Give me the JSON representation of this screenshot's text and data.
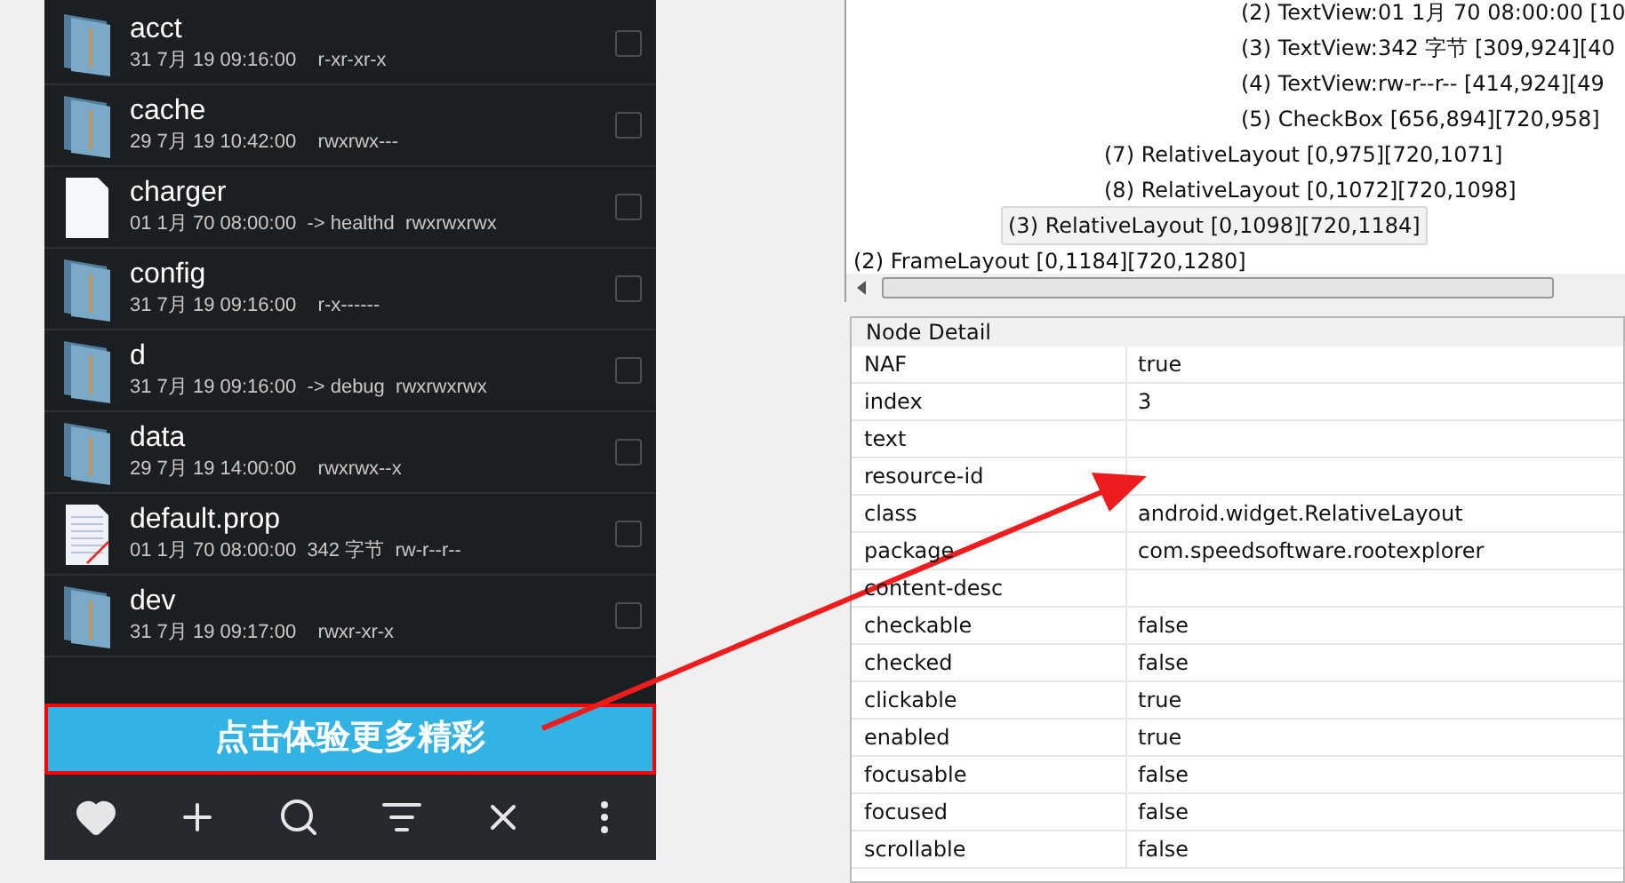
{
  "files": [
    {
      "name": "acct",
      "meta": "31 7月 19 09:16:00    r-xr-xr-x",
      "kind": "folder",
      "checked": false
    },
    {
      "name": "cache",
      "meta": "29 7月 19 10:42:00    rwxrwx---",
      "kind": "folder",
      "checked": false
    },
    {
      "name": "charger",
      "meta": "01 1月 70 08:00:00  -> healthd  rwxrwxrwx",
      "kind": "file",
      "checked": false
    },
    {
      "name": "config",
      "meta": "31 7月 19 09:16:00    r-x------",
      "kind": "folder",
      "checked": false
    },
    {
      "name": "d",
      "meta": "31 7月 19 09:16:00  -> debug  rwxrwxrwx",
      "kind": "folder",
      "checked": false
    },
    {
      "name": "data",
      "meta": "29 7月 19 14:00:00    rwxrwx--x",
      "kind": "folder",
      "checked": false
    },
    {
      "name": "default.prop",
      "meta": "01 1月 70 08:00:00  342 字节  rw-r--r--",
      "kind": "text-file",
      "checked": false
    },
    {
      "name": "dev",
      "meta": "31 7月 19 09:17:00    rwxr-xr-x",
      "kind": "folder",
      "checked": false
    }
  ],
  "banner": {
    "label": "点击体验更多精彩",
    "highlighted": true
  },
  "tree": [
    {
      "children": [
        {
          "children": [
            {
              "children": [
                {
                  "label": "(2) TextView:01 1月 70 08:00:00 [10",
                  "selected": false
                },
                {
                  "label": "(3) TextView:342 字节 [309,924][40",
                  "selected": false
                },
                {
                  "label": "(4) TextView:rw-r--r-- [414,924][49",
                  "selected": false
                },
                {
                  "label": "(5) CheckBox [656,894][720,958]",
                  "selected": false
                }
              ]
            },
            {
              "label": "(7) RelativeLayout [0,975][720,1071]",
              "selected": false
            },
            {
              "label": "(8) RelativeLayout [0,1072][720,1098]",
              "selected": false
            }
          ]
        },
        {
          "label": "(3) RelativeLayout [0,1098][720,1184]",
          "selected": true
        }
      ]
    },
    {
      "label": "(2) FrameLayout [0,1184][720,1280]",
      "selected": false
    }
  ],
  "node_detail": {
    "title": "Node Detail",
    "rows": [
      {
        "key": "NAF",
        "value": "true"
      },
      {
        "key": "index",
        "value": "3"
      },
      {
        "key": "text"
      },
      {
        "key": "resource-id"
      },
      {
        "key": "class",
        "value": "android.widget.RelativeLayout"
      },
      {
        "key": "package",
        "value": "com.speedsoftware.rootexplorer"
      },
      {
        "key": "content-desc"
      },
      {
        "key": "checkable",
        "value": "false"
      },
      {
        "key": "checked",
        "value": "false"
      },
      {
        "key": "clickable",
        "value": "true"
      },
      {
        "key": "enabled",
        "value": "true"
      },
      {
        "key": "focusable",
        "value": "false"
      },
      {
        "key": "focused",
        "value": "false"
      },
      {
        "key": "scrollable",
        "value": "false"
      }
    ]
  }
}
